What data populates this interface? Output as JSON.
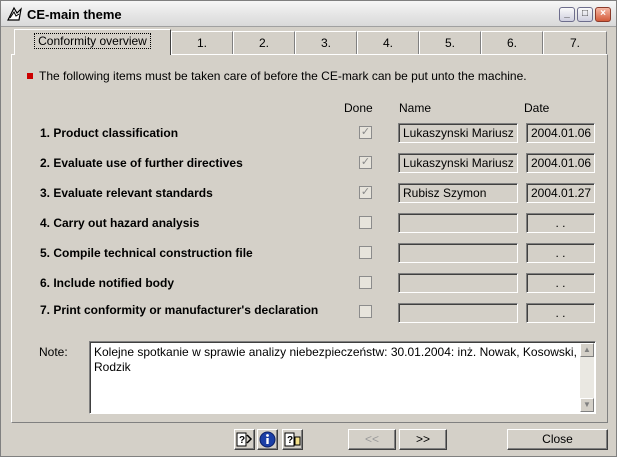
{
  "window": {
    "title": "CE-main theme"
  },
  "tabs": [
    "Conformity overview",
    "1.",
    "2.",
    "3.",
    "4.",
    "5.",
    "6.",
    "7."
  ],
  "intro": "The following items must be taken care of before the CE-mark can be put unto the machine.",
  "columns": {
    "done": "Done",
    "name": "Name",
    "date": "Date"
  },
  "rows": [
    {
      "label": "1. Product classification",
      "done": true,
      "name": "Lukaszynski Mariusz",
      "date": "2004.01.06"
    },
    {
      "label": "2. Evaluate use of further directives",
      "done": true,
      "name": "Lukaszynski Mariusz",
      "date": "2004.01.06"
    },
    {
      "label": "3. Evaluate relevant standards",
      "done": true,
      "name": "Rubisz Szymon",
      "date": "2004.01.27"
    },
    {
      "label": "4. Carry out hazard analysis",
      "done": false,
      "name": "",
      "date": ". ."
    },
    {
      "label": "5. Compile technical construction file",
      "done": false,
      "name": "",
      "date": ". ."
    },
    {
      "label": "6. Include notified body",
      "done": false,
      "name": "",
      "date": ". ."
    },
    {
      "label": "7. Print conformity or manufacturer's declaration",
      "done": false,
      "name": "",
      "date": ". ."
    }
  ],
  "note": {
    "label": "Note:",
    "text": "Kolejne spotkanie w sprawie analizy niebezpieczeństw: 30.01.2004: inż. Nowak, Kosowski, Rodzik"
  },
  "footer": {
    "prev": "<<",
    "next": ">>",
    "close": "Close"
  },
  "icons": [
    "help-icon",
    "info-icon",
    "help-book-icon"
  ]
}
